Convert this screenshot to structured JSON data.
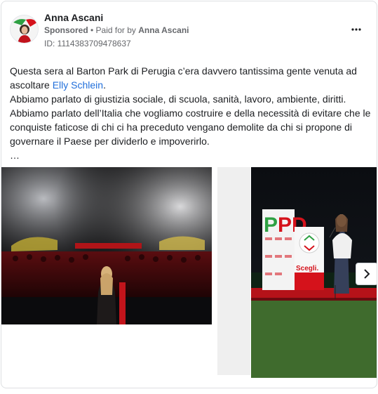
{
  "post": {
    "author": "Anna Ascani",
    "sponsored_label": "Sponsored",
    "separator": " • ",
    "paid_for_prefix": "Paid for by ",
    "paid_for_name": "Anna Ascani",
    "ad_id": "ID: 1114383709478637",
    "text_line1": "Questa sera al Barton Park di Perugia c’era davvero tantissima gente venuta ad ascoltare ",
    "mention": "Elly Schlein",
    "text_line1_end": ".",
    "text_line2": "Abbiamo parlato di giustizia sociale, di scuola, sanità, lavoro, ambiente, diritti.",
    "text_line3": "Abbiamo parlato dell’Italia che vogliamo costruire e della necessità di evitare che le conquiste faticose di chi ci ha preceduto vengano demolite da chi si propone di governare il Paese per dividerlo e impoverirlo.",
    "ellipsis": "…"
  },
  "icons": {
    "more": "more-horizontal-icon",
    "next": "chevron-right-icon"
  },
  "media": {
    "banner_logo": "PD",
    "podium_cta": "Scegli.",
    "colors": {
      "pd_red": "#d5121b",
      "pd_green": "#2ea043",
      "mention_blue": "#216fdb"
    }
  }
}
